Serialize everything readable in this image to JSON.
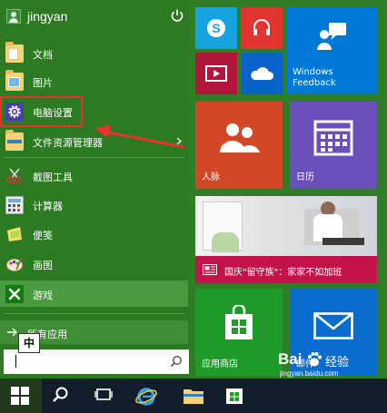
{
  "user": {
    "name": "jingyan"
  },
  "menu": {
    "items": [
      {
        "label": "文档",
        "icon": "documents-folder-icon"
      },
      {
        "label": "图片",
        "icon": "pictures-folder-icon"
      },
      {
        "label": "电脑设置",
        "icon": "gear-icon"
      },
      {
        "label": "文件资源管理器",
        "icon": "file-explorer-icon"
      }
    ],
    "apps": [
      {
        "label": "截图工具",
        "icon": "snipping-tool-icon"
      },
      {
        "label": "计算器",
        "icon": "calculator-icon"
      },
      {
        "label": "便笺",
        "icon": "sticky-notes-icon"
      },
      {
        "label": "画图",
        "icon": "paint-icon"
      },
      {
        "label": "游戏",
        "icon": "xbox-games-icon"
      }
    ],
    "all_apps_label": "所有应用",
    "ime_label": "中",
    "search_value": ""
  },
  "tiles": {
    "people": "人脉",
    "calendar": "日历",
    "feedback": "Windows\nFeedback",
    "news": "国庆\"留守族\"：家家不如加班",
    "store": "应用商店",
    "mail": "邮件"
  },
  "watermark": {
    "brand_left": "Bai",
    "brand_right": "经验",
    "url": "jingyan.baidu.com"
  },
  "colors": {
    "menu_bg": "#2c7a22",
    "tile_blue": "#15a3df",
    "tile_orange": "#d24726",
    "tile_red": "#e13532",
    "tile_darkblue": "#0078d7",
    "tile_purple": "#6b4fbb",
    "tile_green": "#1e9b28",
    "tile_news": "#c4124b",
    "highlight_red": "#e8322b"
  }
}
